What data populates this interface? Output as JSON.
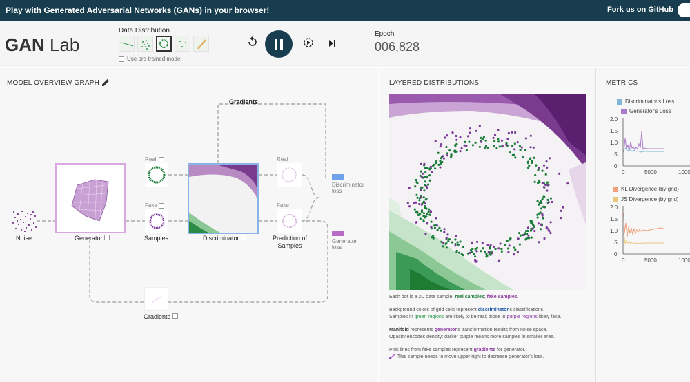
{
  "topbar": {
    "title": "Play with Generated Adversarial Networks (GANs) in your browser!",
    "fork": "Fork us on GitHub"
  },
  "header": {
    "logo_bold": "GAN",
    "logo_rest": " Lab",
    "data_distribution_label": "Data Distribution",
    "pretrained_label": "Use pre-trained model",
    "epoch_label": "Epoch",
    "epoch_value": "006,828",
    "thumbs": [
      "line",
      "gaussians",
      "ring",
      "dots",
      "diagonal"
    ],
    "selected_thumb": "ring"
  },
  "model": {
    "title": "MODEL OVERVIEW GRAPH",
    "gradients_top": "Gradients",
    "noise": "Noise",
    "generator": "Generator",
    "samples": "Samples",
    "discriminator": "Discriminator",
    "prediction": "Prediction of",
    "prediction2": "Samples",
    "real": "Real",
    "fake": "Fake",
    "real2": "Real",
    "fake2": "Fake",
    "disc_loss": "Discriminator",
    "disc_loss2": "loss",
    "gen_loss": "Generator",
    "gen_loss2": "loss",
    "gradients_bottom": "Gradients"
  },
  "layered": {
    "title": "LAYERED DISTRIBUTIONS",
    "line1_a": "Each dot is a 2D data sample: ",
    "line1_real": "real samples",
    "line1_sep": "; ",
    "line1_fake": "fake samples",
    "line1_end": ".",
    "line2_a": "Background colors of grid cells represent ",
    "line2_disc": "discriminator",
    "line2_b": "'s classifications.",
    "line3_a": "Samples in ",
    "line3_green": "green regions",
    "line3_b": " are likely to be real; those in ",
    "line3_purple": "purple regions",
    "line3_c": " likely fake.",
    "line4_bold": "Manifold",
    "line4_a": " represents ",
    "line4_gen": "generator",
    "line4_b": "'s transformation results from noise space.",
    "line5": "Opacity encodes density: darker purple means more samples in smaller area.",
    "line6_a": "Pink lines from fake samples represent ",
    "line6_grad": "gradients",
    "line6_b": " for generator.",
    "line7": "This sample needs to move upper right to decrease generator's loss."
  },
  "metrics": {
    "title": "METRICS",
    "legend1": "Discriminator's Loss",
    "legend2": "Generator's Loss",
    "legend3": "KL Divergence (by grid)",
    "legend4": "JS Divergence (by grid)",
    "y_ticks": [
      "2.0",
      "1.5",
      "1.0",
      ".5",
      "0"
    ],
    "x_ticks": [
      "0",
      "5000",
      "1000"
    ],
    "colors": {
      "disc_loss": "#7fb5d9",
      "gen_loss": "#a87cc9",
      "kl": "#f0a07a",
      "js": "#e8c77a"
    }
  },
  "colors": {
    "dark_blue": "#183d4e",
    "real_green": "#1c7d3a",
    "fake_purple": "#7b3a99"
  }
}
